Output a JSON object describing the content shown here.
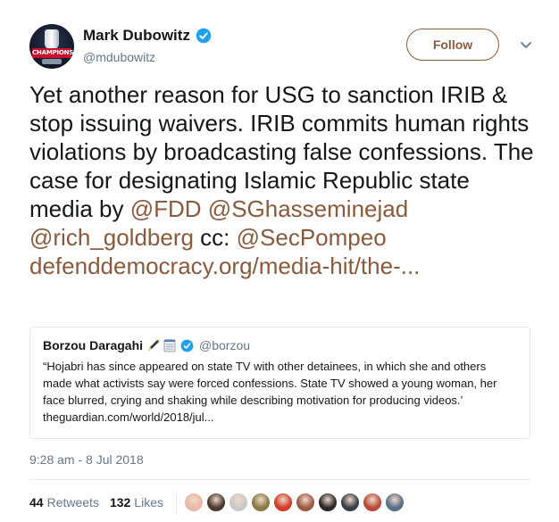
{
  "author": {
    "name": "Mark Dubowitz",
    "handle": "@mdubowitz",
    "avatar_text": "CHAMPIONS",
    "verified_icon": "verified-badge"
  },
  "follow_label": "Follow",
  "tweet": {
    "text_plain": "Yet another reason for USG to sanction IRIB & stop issuing waivers. IRIB commits human rights violations by broadcasting false confessions. The case for designating Islamic Republic state media by ",
    "mention_1": "@FDD",
    "space_1": " ",
    "mention_2": "@SGhasseminejad",
    "space_2": " ",
    "mention_3": "@rich_goldberg",
    "cc_text": " cc: ",
    "mention_4": "@SecPompeo",
    "space_3": " ",
    "link": "defenddemocracy.org/media-hit/the-..."
  },
  "quote": {
    "name": "Borzou Daragahi",
    "handle": "@borzou",
    "emojis": [
      "pen-icon",
      "notepad-icon"
    ],
    "text": "“Hojabri has since appeared on state TV with other detainees, in which she and others made what activists say were forced confessions. State TV showed a young woman, her face blurred, crying and shaking while describing motivation for producing videos.’ theguardian.com/world/2018/jul..."
  },
  "timestamp": "9:28 am - 8 Jul 2018",
  "stats": {
    "retweets_count": "44",
    "retweets_label": "Retweets",
    "likes_count": "132",
    "likes_label": "Likes"
  },
  "likers": [
    "#e8b9a8",
    "#4a3a30",
    "#c9c9c9",
    "#8a7a4a",
    "#d23b2a",
    "#9c5a44",
    "#2a2a2a",
    "#3a3f48",
    "#b84a3a",
    "#5a7088"
  ],
  "colors": {
    "link": "#8a5a3c",
    "verified": "#1da1f2",
    "muted": "#657786"
  }
}
